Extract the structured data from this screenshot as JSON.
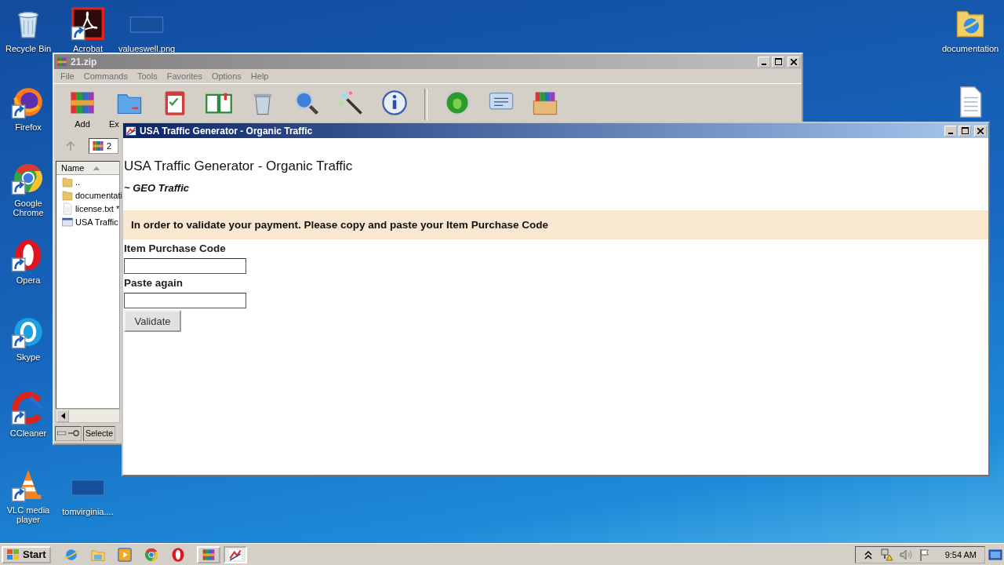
{
  "desktop_icons": [
    {
      "label": "Recycle Bin",
      "kind": "recycle-bin",
      "shortcut": false
    },
    {
      "label": "Acrobat",
      "kind": "acrobat",
      "shortcut": true
    },
    {
      "label": "valueswell.png",
      "kind": "thumbnail",
      "shortcut": false
    },
    {
      "label": "Firefox",
      "kind": "firefox",
      "shortcut": true
    },
    {
      "label": "Google Chrome",
      "kind": "chrome",
      "shortcut": true
    },
    {
      "label": "Opera",
      "kind": "opera",
      "shortcut": true
    },
    {
      "label": "Skype",
      "kind": "skype",
      "shortcut": true
    },
    {
      "label": "CCleaner",
      "kind": "ccleaner",
      "shortcut": true
    },
    {
      "label": "VLC media player",
      "kind": "vlc",
      "shortcut": true
    },
    {
      "label": "tomvirginia....",
      "kind": "thumbnail",
      "shortcut": false
    },
    {
      "label": "documentation",
      "kind": "ie-folder",
      "shortcut": false
    },
    {
      "kind": "text-file",
      "shortcut": false
    }
  ],
  "archiver_window": {
    "title": "21.zip",
    "menu": [
      "File",
      "Commands",
      "Tools",
      "Favorites",
      "Options",
      "Help"
    ],
    "toolbar": [
      {
        "kind": "add",
        "label": "Add"
      },
      {
        "kind": "extract",
        "label": "Ex"
      },
      {
        "kind": "test"
      },
      {
        "kind": "view"
      },
      {
        "kind": "delete"
      },
      {
        "kind": "find"
      },
      {
        "kind": "wizard"
      },
      {
        "kind": "info"
      },
      {
        "kind": "separator"
      },
      {
        "kind": "virus-scan"
      },
      {
        "kind": "comment"
      },
      {
        "kind": "sfx"
      }
    ],
    "path": "2",
    "columns": [
      "Name"
    ],
    "files": [
      {
        "name": "..",
        "kind": "folder"
      },
      {
        "name": "documentati",
        "kind": "folder"
      },
      {
        "name": "license.txt *",
        "kind": "text"
      },
      {
        "name": "USA Traffic",
        "kind": "app"
      }
    ],
    "status": "Selecte"
  },
  "app_window": {
    "title": "USA Traffic Generator - Organic Traffic",
    "heading": "USA Traffic Generator - Organic Traffic",
    "subheading": "~ GEO Traffic",
    "notice": "In order to validate your payment. Please copy and paste your Item Purchase Code",
    "fields": [
      {
        "label": "Item Purchase Code"
      },
      {
        "label": "Paste again"
      }
    ],
    "button": "Validate"
  },
  "taskbar": {
    "start": "Start",
    "quick_launch": [
      {
        "kind": "ie"
      },
      {
        "kind": "explorer"
      },
      {
        "kind": "media-player"
      },
      {
        "kind": "chrome"
      },
      {
        "kind": "opera"
      }
    ],
    "tasks": [
      {
        "kind": "winrar",
        "selected": false
      },
      {
        "kind": "traffic",
        "selected": true
      }
    ],
    "clock": "9:54 AM"
  }
}
